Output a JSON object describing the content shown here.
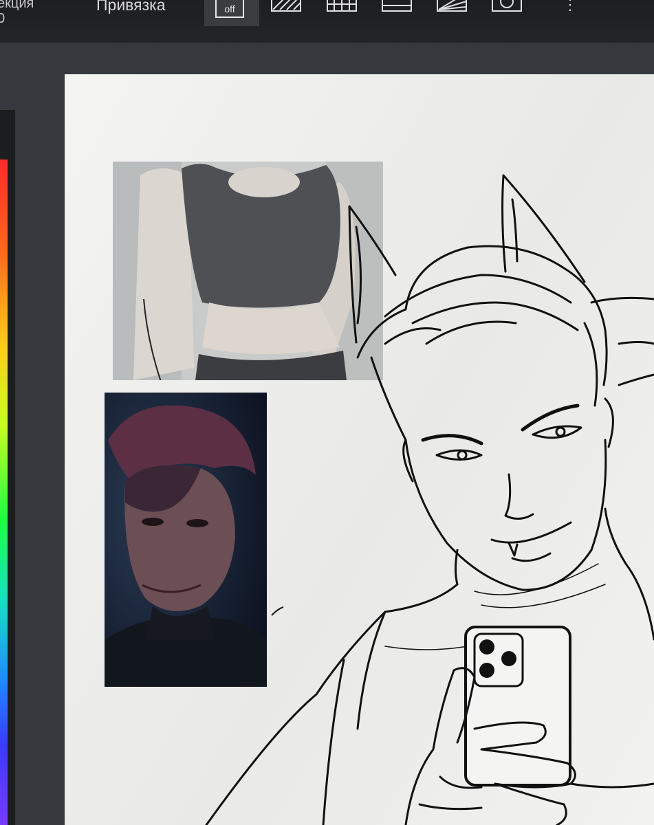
{
  "toolbar": {
    "cut_label_fragment": "екция",
    "cut_value_fragment": "0",
    "snap_label": "Привязка",
    "snap_toggle": "off",
    "more_glyph": "⋮",
    "tools": [
      "hatch-icon",
      "grid-icon",
      "lines-icon",
      "rays-icon",
      "circle-icon"
    ]
  },
  "palette": {
    "colors": [
      "#ff2a2a",
      "#ff6a1a",
      "#ffcc1a",
      "#c6ff22",
      "#1eff40",
      "#16e0c0",
      "#1e8dff",
      "#3a3aff",
      "#7a3aff"
    ]
  },
  "canvas": {
    "background": "#f0f0ee",
    "references": [
      "torso-reference-photo",
      "portrait-reference-photo"
    ],
    "drawing": "lineart-selfie-with-phone"
  }
}
